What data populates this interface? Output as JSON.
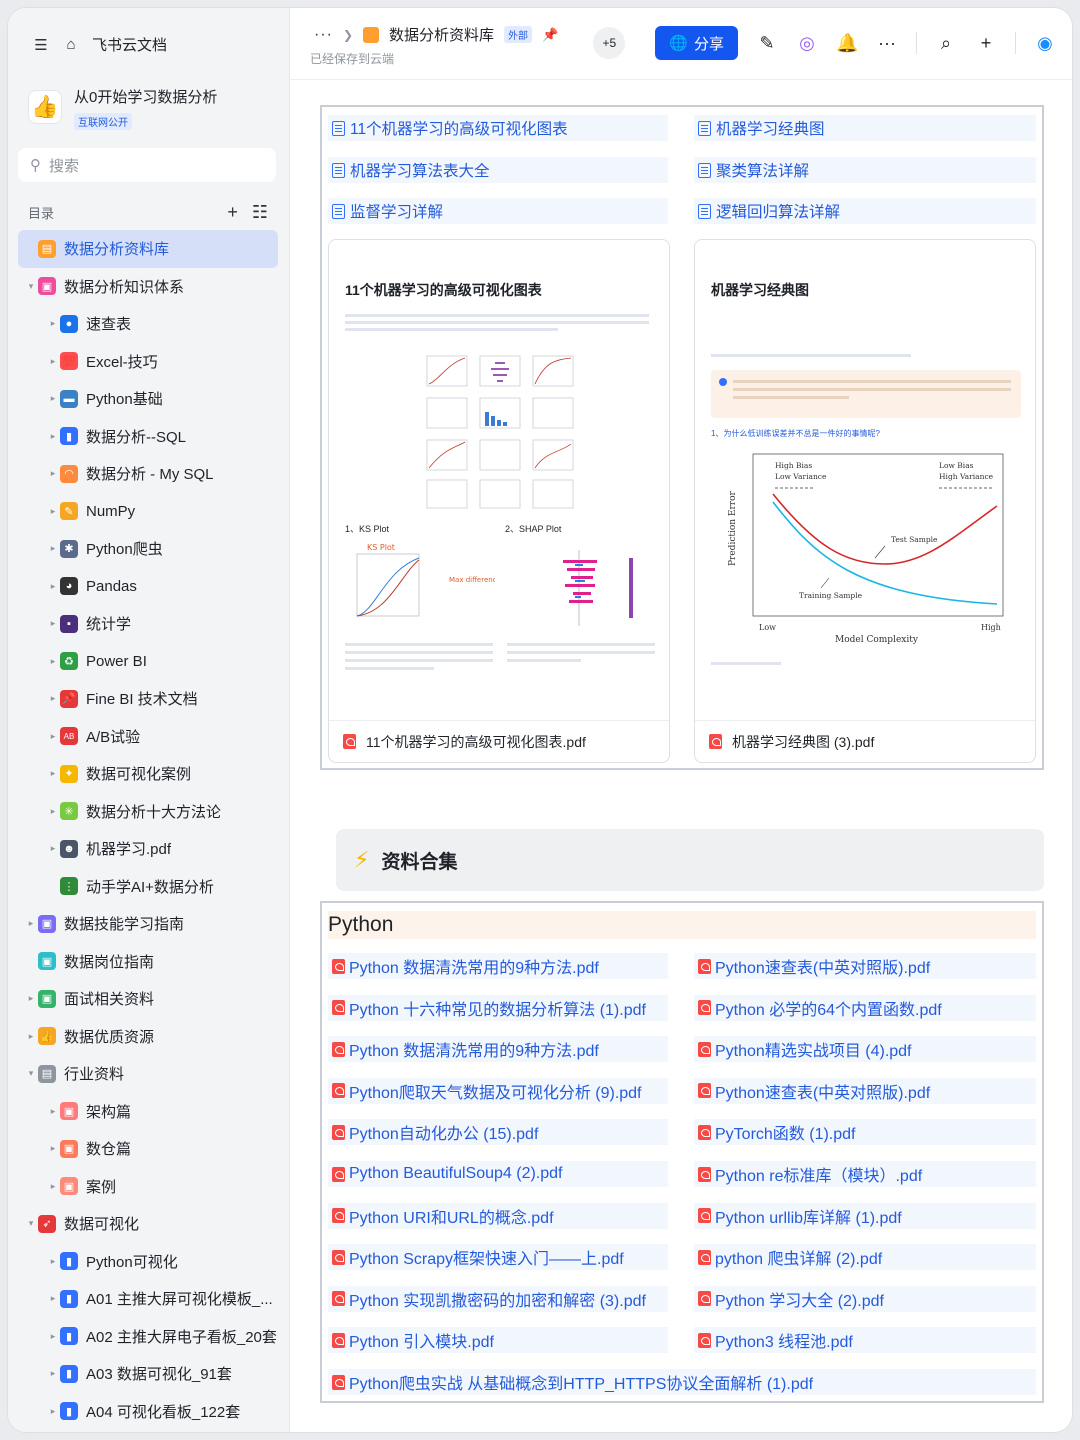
{
  "sidebar": {
    "app_title": "飞书云文档",
    "space_title": "从0开始学习数据分析",
    "space_badge": "互联网公开",
    "search_placeholder": "搜索",
    "toc_label": "目录",
    "tree": [
      {
        "label": "数据分析资料库",
        "level": 0,
        "arrow": "",
        "icon_color": "#ff9f2e",
        "icon": "doc-icon",
        "active": true
      },
      {
        "label": "数据分析知识体系",
        "level": 0,
        "arrow": "▾",
        "icon_color": "#f04c9d",
        "icon": "board-icon"
      },
      {
        "label": "速查表",
        "level": 1,
        "arrow": "▸",
        "icon_color": "#1a73e8",
        "icon": "magnifier-icon"
      },
      {
        "label": "Excel-技巧",
        "level": 1,
        "arrow": "▸",
        "icon_color": "#ff4d4f",
        "icon": "hundred-icon"
      },
      {
        "label": "Python基础",
        "level": 1,
        "arrow": "▸",
        "icon_color": "#3b82c4",
        "icon": "monitor-icon"
      },
      {
        "label": "数据分析--SQL",
        "level": 1,
        "arrow": "▸",
        "icon_color": "#3370ff",
        "icon": "bar-chart-icon"
      },
      {
        "label": "数据分析 - My SQL",
        "level": 1,
        "arrow": "▸",
        "icon_color": "#ff8a3d",
        "icon": "rainbow-icon"
      },
      {
        "label": "NumPy",
        "level": 1,
        "arrow": "▸",
        "icon_color": "#f5a623",
        "icon": "pencil-icon"
      },
      {
        "label": "Python爬虫",
        "level": 1,
        "arrow": "▸",
        "icon_color": "#5b6b8c",
        "icon": "spider-icon"
      },
      {
        "label": "Pandas",
        "level": 1,
        "arrow": "▸",
        "icon_color": "#333333",
        "icon": "panda-icon"
      },
      {
        "label": "统计学",
        "level": 1,
        "arrow": "▸",
        "icon_color": "#4a2f7a",
        "icon": "floppy-icon"
      },
      {
        "label": "Power BI",
        "level": 1,
        "arrow": "▸",
        "icon_color": "#2ea043",
        "icon": "recycle-icon"
      },
      {
        "label": "Fine BI 技术文档",
        "level": 1,
        "arrow": "▸",
        "icon_color": "#e5383b",
        "icon": "pin-icon"
      },
      {
        "label": "A/B试验",
        "level": 1,
        "arrow": "▸",
        "icon_color": "#e5383b",
        "icon": "ab-icon"
      },
      {
        "label": "数据可视化案例",
        "level": 1,
        "arrow": "▸",
        "icon_color": "#f5b700",
        "icon": "medal-icon"
      },
      {
        "label": "数据分析十大方法论",
        "level": 1,
        "arrow": "▸",
        "icon_color": "#7ac943",
        "icon": "sparkle-icon"
      },
      {
        "label": "机器学习.pdf",
        "level": 1,
        "arrow": "▸",
        "icon_color": "#4a5568",
        "icon": "robot-icon"
      },
      {
        "label": "动手学AI+数据分析",
        "level": 1,
        "arrow": "",
        "icon_color": "#2f8a3a",
        "icon": "traffic-light-icon"
      },
      {
        "label": "数据技能学习指南",
        "level": 0,
        "arrow": "▸",
        "icon_color": "#7b6cf6",
        "icon": "board-icon"
      },
      {
        "label": "数据岗位指南",
        "level": 0,
        "arrow": "",
        "icon_color": "#2bc0c9",
        "icon": "board-icon"
      },
      {
        "label": "面试相关资料",
        "level": 0,
        "arrow": "▸",
        "icon_color": "#34b36a",
        "icon": "board-icon"
      },
      {
        "label": "数据优质资源",
        "level": 0,
        "arrow": "▸",
        "icon_color": "#f5a623",
        "icon": "thumb-icon"
      },
      {
        "label": "行业资料",
        "level": 0,
        "arrow": "▾",
        "icon_color": "#8f959e",
        "icon": "doc-icon"
      },
      {
        "label": "架构篇",
        "level": 1,
        "arrow": "▸",
        "icon_color": "#ff7a7a",
        "icon": "board-icon"
      },
      {
        "label": "数仓篇",
        "level": 1,
        "arrow": "▸",
        "icon_color": "#ff7a5a",
        "icon": "board-icon"
      },
      {
        "label": "案例",
        "level": 1,
        "arrow": "▸",
        "icon_color": "#ff8a7a",
        "icon": "board-icon"
      },
      {
        "label": "数据可视化",
        "level": 0,
        "arrow": "▾",
        "icon_color": "#e5383b",
        "icon": "rocket-icon"
      },
      {
        "label": "Python可视化",
        "level": 1,
        "arrow": "▸",
        "icon_color": "#3370ff",
        "icon": "bar-chart-icon"
      },
      {
        "label": "A01 主推大屏可视化模板_...",
        "level": 1,
        "arrow": "▸",
        "icon_color": "#3370ff",
        "icon": "bar-chart-icon"
      },
      {
        "label": "A02 主推大屏电子看板_20套",
        "level": 1,
        "arrow": "▸",
        "icon_color": "#3370ff",
        "icon": "bar-chart-icon"
      },
      {
        "label": "A03 数据可视化_91套",
        "level": 1,
        "arrow": "▸",
        "icon_color": "#3370ff",
        "icon": "bar-chart-icon"
      },
      {
        "label": "A04 可视化看板_122套",
        "level": 1,
        "arrow": "▸",
        "icon_color": "#3370ff",
        "icon": "bar-chart-icon"
      }
    ]
  },
  "header": {
    "more": "···",
    "doc_title": "数据分析资料库",
    "external_badge": "外部",
    "saved_status": "已经保存到云端",
    "collab_count": "+5",
    "share_label": "分享"
  },
  "links_top": [
    "11个机器学习的高级可视化图表",
    "机器学习经典图",
    "机器学习算法表大全",
    "聚类算法详解",
    "监督学习详解",
    "逻辑回归算法详解"
  ],
  "cards": {
    "left": {
      "title": "11个机器学习的高级可视化图表",
      "ks_label": "1、KS Plot",
      "shap_label": "2、SHAP Plot",
      "ks_plot_title": "KS Plot",
      "ks_annotation": "Max difference",
      "file": "11个机器学习的高级可视化图表.pdf"
    },
    "right": {
      "title": "机器学习经典图",
      "question": "1、为什么低训练误差并不总是一件好的事情呢?",
      "ylabel": "Prediction Error",
      "xlabel": "Model Complexity",
      "x_low": "Low",
      "x_high": "High",
      "hb_lv": "High Bias\nLow Variance",
      "lb_hv": "Low Bias\nHigh Variance",
      "test_sample": "Test Sample",
      "training_sample": "Training Sample",
      "file": "机器学习经典图 (3).pdf"
    }
  },
  "callout": {
    "text": "资料合集"
  },
  "python_section": {
    "heading": "Python",
    "files_left": [
      "Python 数据清洗常用的9种方法.pdf",
      "Python 十六种常见的数据分析算法 (1).pdf",
      "Python 数据清洗常用的9种方法.pdf",
      "Python爬取天气数据及可视化分析 (9).pdf",
      "Python自动化办公 (15).pdf",
      "Python BeautifulSoup4 (2).pdf",
      "Python URI和URL的概念.pdf",
      "Python  Scrapy框架快速入门——上.pdf",
      "Python 实现凯撒密码的加密和解密 (3).pdf",
      "Python 引入模块.pdf"
    ],
    "files_right": [
      "Python速查表(中英对照版).pdf",
      "Python 必学的64个内置函数.pdf",
      "Python精选实战项目 (4).pdf",
      "Python速查表(中英对照版).pdf",
      "PyTorch函数 (1).pdf",
      "Python re标准库（模块）.pdf",
      "Python urllib库详解 (1).pdf",
      "python 爬虫详解 (2).pdf",
      "Python 学习大全 (2).pdf",
      "Python3 线程池.pdf"
    ],
    "file_full": "Python爬虫实战 从基础概念到HTTP_HTTPS协议全面解析 (1).pdf"
  }
}
